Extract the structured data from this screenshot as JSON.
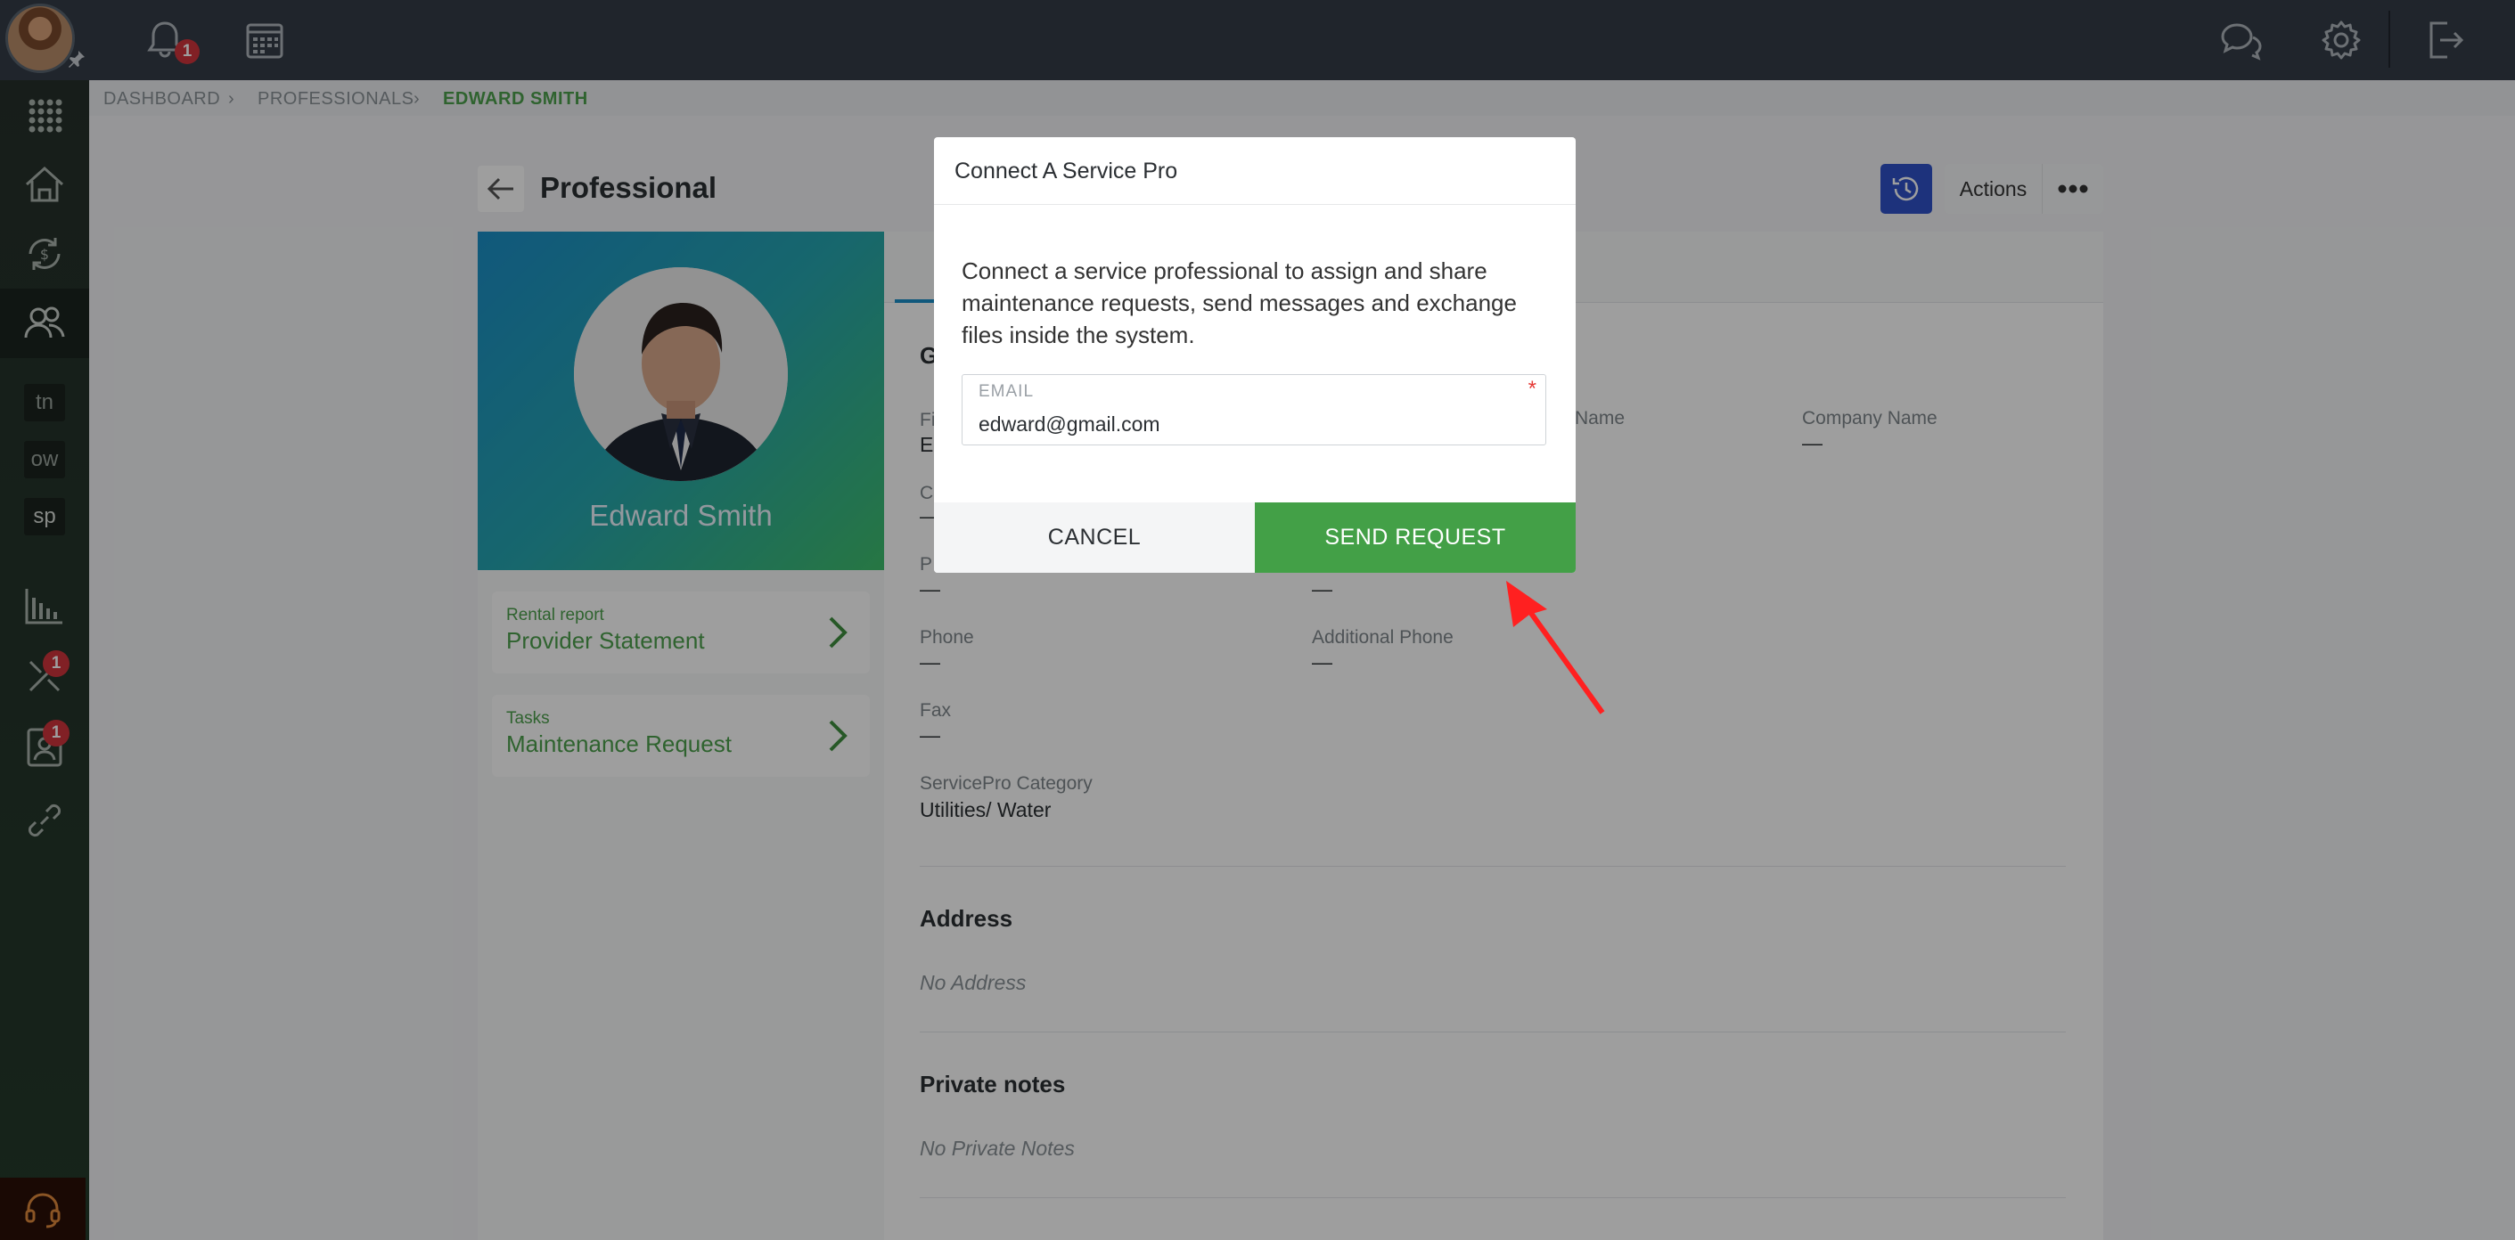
{
  "topbar": {
    "notification_count": "1",
    "icons": [
      "user-avatar",
      "pin-icon",
      "bell-icon",
      "calendar-icon",
      "chat-icon",
      "gear-icon",
      "logout-icon"
    ]
  },
  "sidebar": {
    "items": [
      {
        "name": "apps-grid-icon"
      },
      {
        "name": "home-icon"
      },
      {
        "name": "money-cycle-icon"
      },
      {
        "name": "people-icon"
      },
      {
        "label": "tn"
      },
      {
        "label": "ow"
      },
      {
        "label": "sp"
      },
      {
        "name": "bar-chart-icon"
      },
      {
        "name": "tools-icon",
        "badge": "1"
      },
      {
        "name": "contact-card-icon",
        "badge": "1"
      },
      {
        "name": "link-icon"
      }
    ],
    "support_icon": "headset-icon"
  },
  "breadcrumb": {
    "items": [
      "DASHBOARD",
      "PROFESSIONALS",
      "EDWARD SMITH"
    ]
  },
  "page": {
    "title": "Professional",
    "actions_label": "Actions"
  },
  "profile": {
    "name": "Edward Smith",
    "links": [
      {
        "caption": "Rental report",
        "title": "Provider Statement"
      },
      {
        "caption": "Tasks",
        "title": "Maintenance Request"
      }
    ]
  },
  "details": {
    "section_g": "G",
    "first_name_label": "Fi",
    "first_name_value": "Ed",
    "c_label": "C",
    "c_value": "—",
    "last_name_label": "Name",
    "company_name_label": "Company Name",
    "company_name_value": "—",
    "p_label": "P",
    "p_value": "—",
    "p2_value": "—",
    "phone_label": "Phone",
    "phone_value": "—",
    "additional_phone_label": "Additional Phone",
    "additional_phone_value": "—",
    "fax_label": "Fax",
    "fax_value": "—",
    "category_label": "ServicePro Category",
    "category_value": "Utilities/ Water",
    "address_title": "Address",
    "address_empty": "No Address",
    "notes_title": "Private notes",
    "notes_empty": "No Private Notes"
  },
  "modal": {
    "title": "Connect A Service Pro",
    "description": "Connect a service professional to assign and share maintenance requests, send messages and exchange files inside the system.",
    "email_label": "EMAIL",
    "email_required": "*",
    "email_value": "edward@gmail.com",
    "cancel_label": "CANCEL",
    "send_label": "SEND REQUEST"
  },
  "colors": {
    "topbar": "#343d47",
    "accent_green": "#43a047",
    "primary_blue": "#2f52c8",
    "badge_red": "#d0343d",
    "annotation_arrow": "#ff2020"
  }
}
